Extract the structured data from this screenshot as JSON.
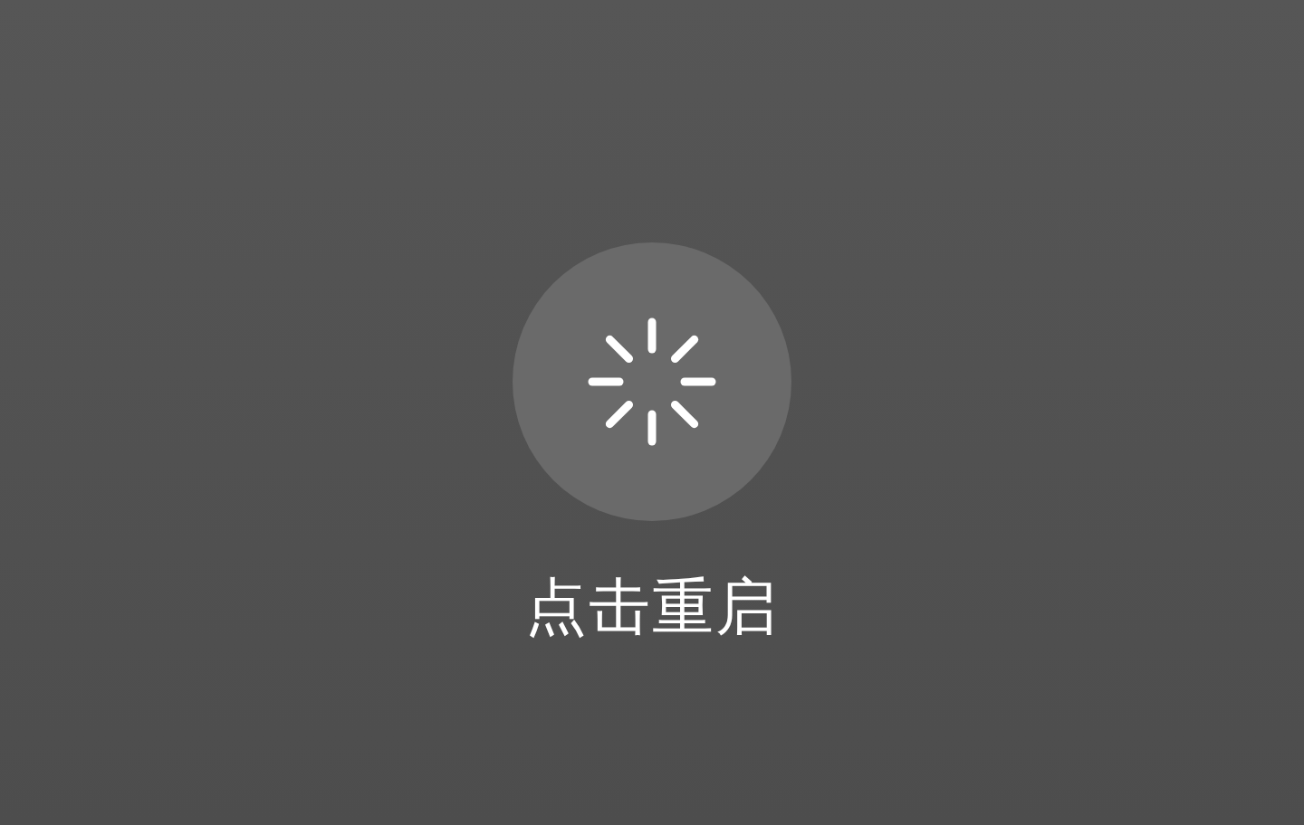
{
  "restart": {
    "label": "点击重启"
  }
}
